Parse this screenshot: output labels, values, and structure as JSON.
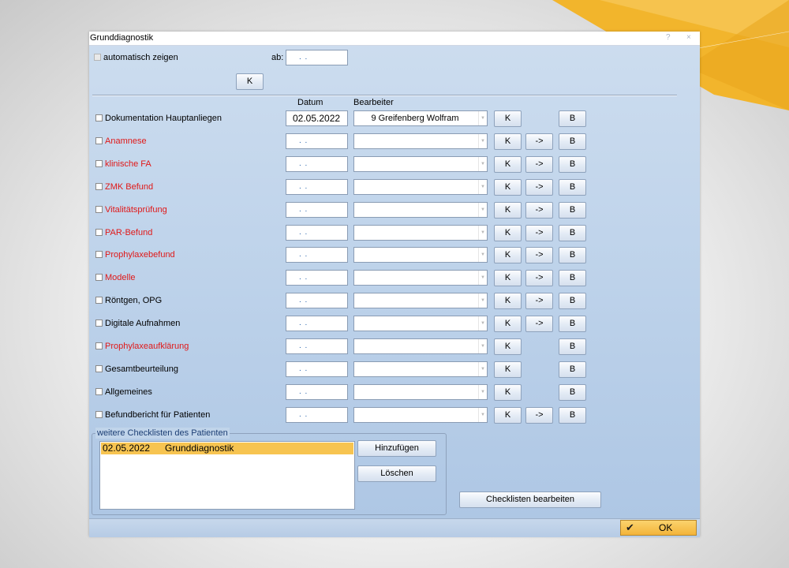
{
  "window": {
    "title": "Grunddiagnostik",
    "help_symbol": "?",
    "close_symbol": "×"
  },
  "top": {
    "auto_show_label": "automatisch zeigen",
    "ab_label": "ab:",
    "ab_value": ". .",
    "k_button": "K"
  },
  "headers": {
    "datum": "Datum",
    "bearbeiter": "Bearbeiter"
  },
  "rows": [
    {
      "label": "Dokumentation Hauptanliegen",
      "color": "#000000",
      "date": "02.05.2022",
      "editor": "9 Greifenberg Wolfram",
      "k": "K",
      "arrow": "",
      "b": "B"
    },
    {
      "label": "Anamnese",
      "color": "#e01818",
      "date": ". .",
      "editor": "",
      "k": "K",
      "arrow": "->",
      "b": "B"
    },
    {
      "label": "klinische FA",
      "color": "#e01818",
      "date": ". .",
      "editor": "",
      "k": "K",
      "arrow": "->",
      "b": "B"
    },
    {
      "label": "ZMK Befund",
      "color": "#e01818",
      "date": ". .",
      "editor": "",
      "k": "K",
      "arrow": "->",
      "b": "B"
    },
    {
      "label": "Vitalitätsprüfung",
      "color": "#e01818",
      "date": ". .",
      "editor": "",
      "k": "K",
      "arrow": "->",
      "b": "B"
    },
    {
      "label": "PAR-Befund",
      "color": "#e01818",
      "date": ". .",
      "editor": "",
      "k": "K",
      "arrow": "->",
      "b": "B"
    },
    {
      "label": "Prophylaxebefund",
      "color": "#e01818",
      "date": ". .",
      "editor": "",
      "k": "K",
      "arrow": "->",
      "b": "B"
    },
    {
      "label": "Modelle",
      "color": "#e01818",
      "date": ". .",
      "editor": "",
      "k": "K",
      "arrow": "->",
      "b": "B"
    },
    {
      "label": "Röntgen, OPG",
      "color": "#000000",
      "date": ". .",
      "editor": "",
      "k": "K",
      "arrow": "->",
      "b": "B"
    },
    {
      "label": "Digitale Aufnahmen",
      "color": "#000000",
      "date": ". .",
      "editor": "",
      "k": "K",
      "arrow": "->",
      "b": "B"
    },
    {
      "label": "Prophylaxeaufklärung",
      "color": "#e01818",
      "date": ". .",
      "editor": "",
      "k": "K",
      "arrow": "",
      "b": "B"
    },
    {
      "label": "Gesamtbeurteilung",
      "color": "#000000",
      "date": ". .",
      "editor": "",
      "k": "K",
      "arrow": "",
      "b": "B"
    },
    {
      "label": "Allgemeines",
      "color": "#000000",
      "date": ". .",
      "editor": "",
      "k": "K",
      "arrow": "",
      "b": "B"
    },
    {
      "label": "Befundbericht für Patienten",
      "color": "#000000",
      "date": ". .",
      "editor": "",
      "k": "K",
      "arrow": "->",
      "b": "B"
    }
  ],
  "checklists": {
    "group_label": "weitere Checklisten des Patienten",
    "items": [
      {
        "date": "02.05.2022",
        "name": "Grunddiagnostik"
      }
    ],
    "add_button": "Hinzufügen",
    "delete_button": "Löschen",
    "edit_button": "Checklisten bearbeiten"
  },
  "footer": {
    "ok_button": "OK",
    "ok_icon": "checkmark-icon"
  },
  "colors": {
    "accent": "#f3b43a",
    "required_text": "#e01818",
    "window_bg": "#bdd2ea"
  }
}
